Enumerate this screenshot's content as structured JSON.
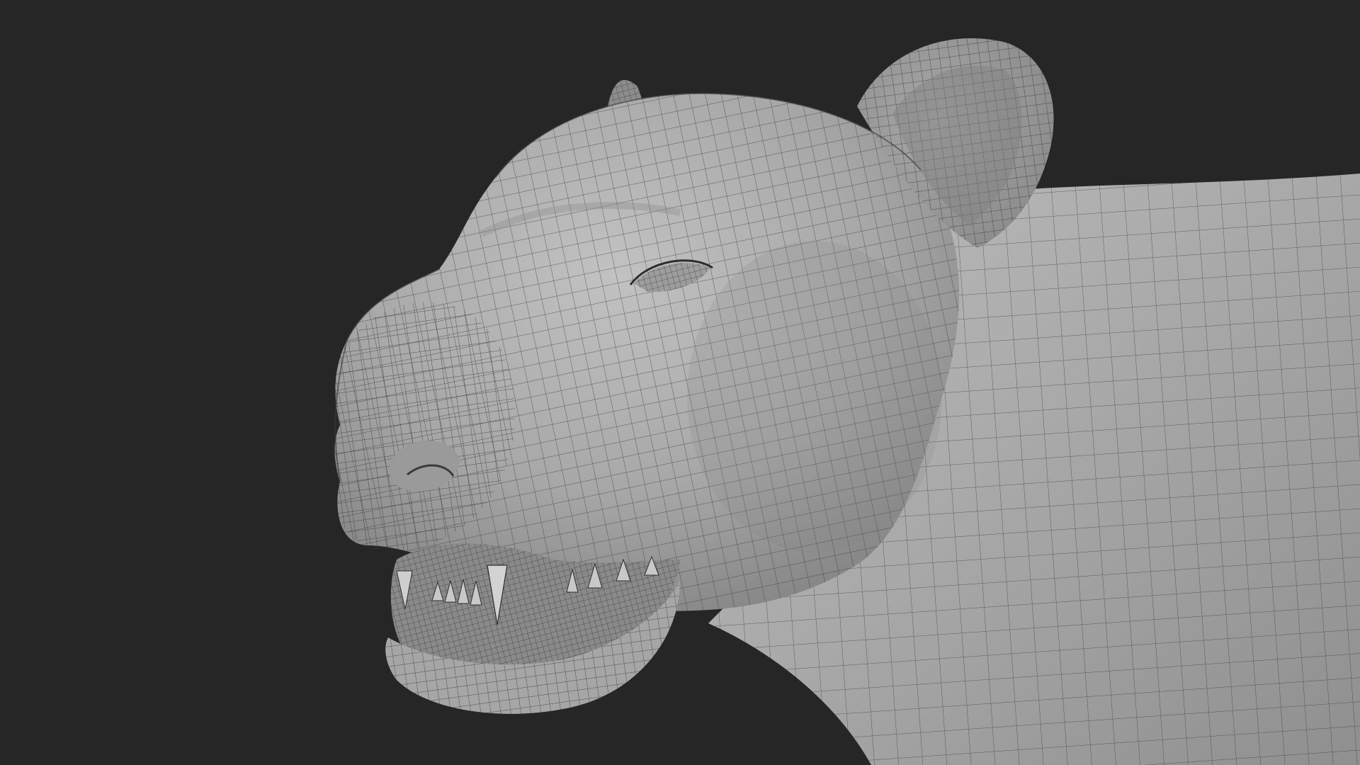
{
  "viewport": {
    "background_color": "#262626",
    "subject": "panther-head-wireframe-icon"
  },
  "colors": {
    "mesh_surface": "#a9a9a9",
    "mesh_highlight": "#c4c4c4",
    "mesh_shadow": "#7a7a7a",
    "wire_line": "#2e2e2e",
    "mouth_interior": "#8a8a8a",
    "tooth": "#cfcfcf"
  }
}
